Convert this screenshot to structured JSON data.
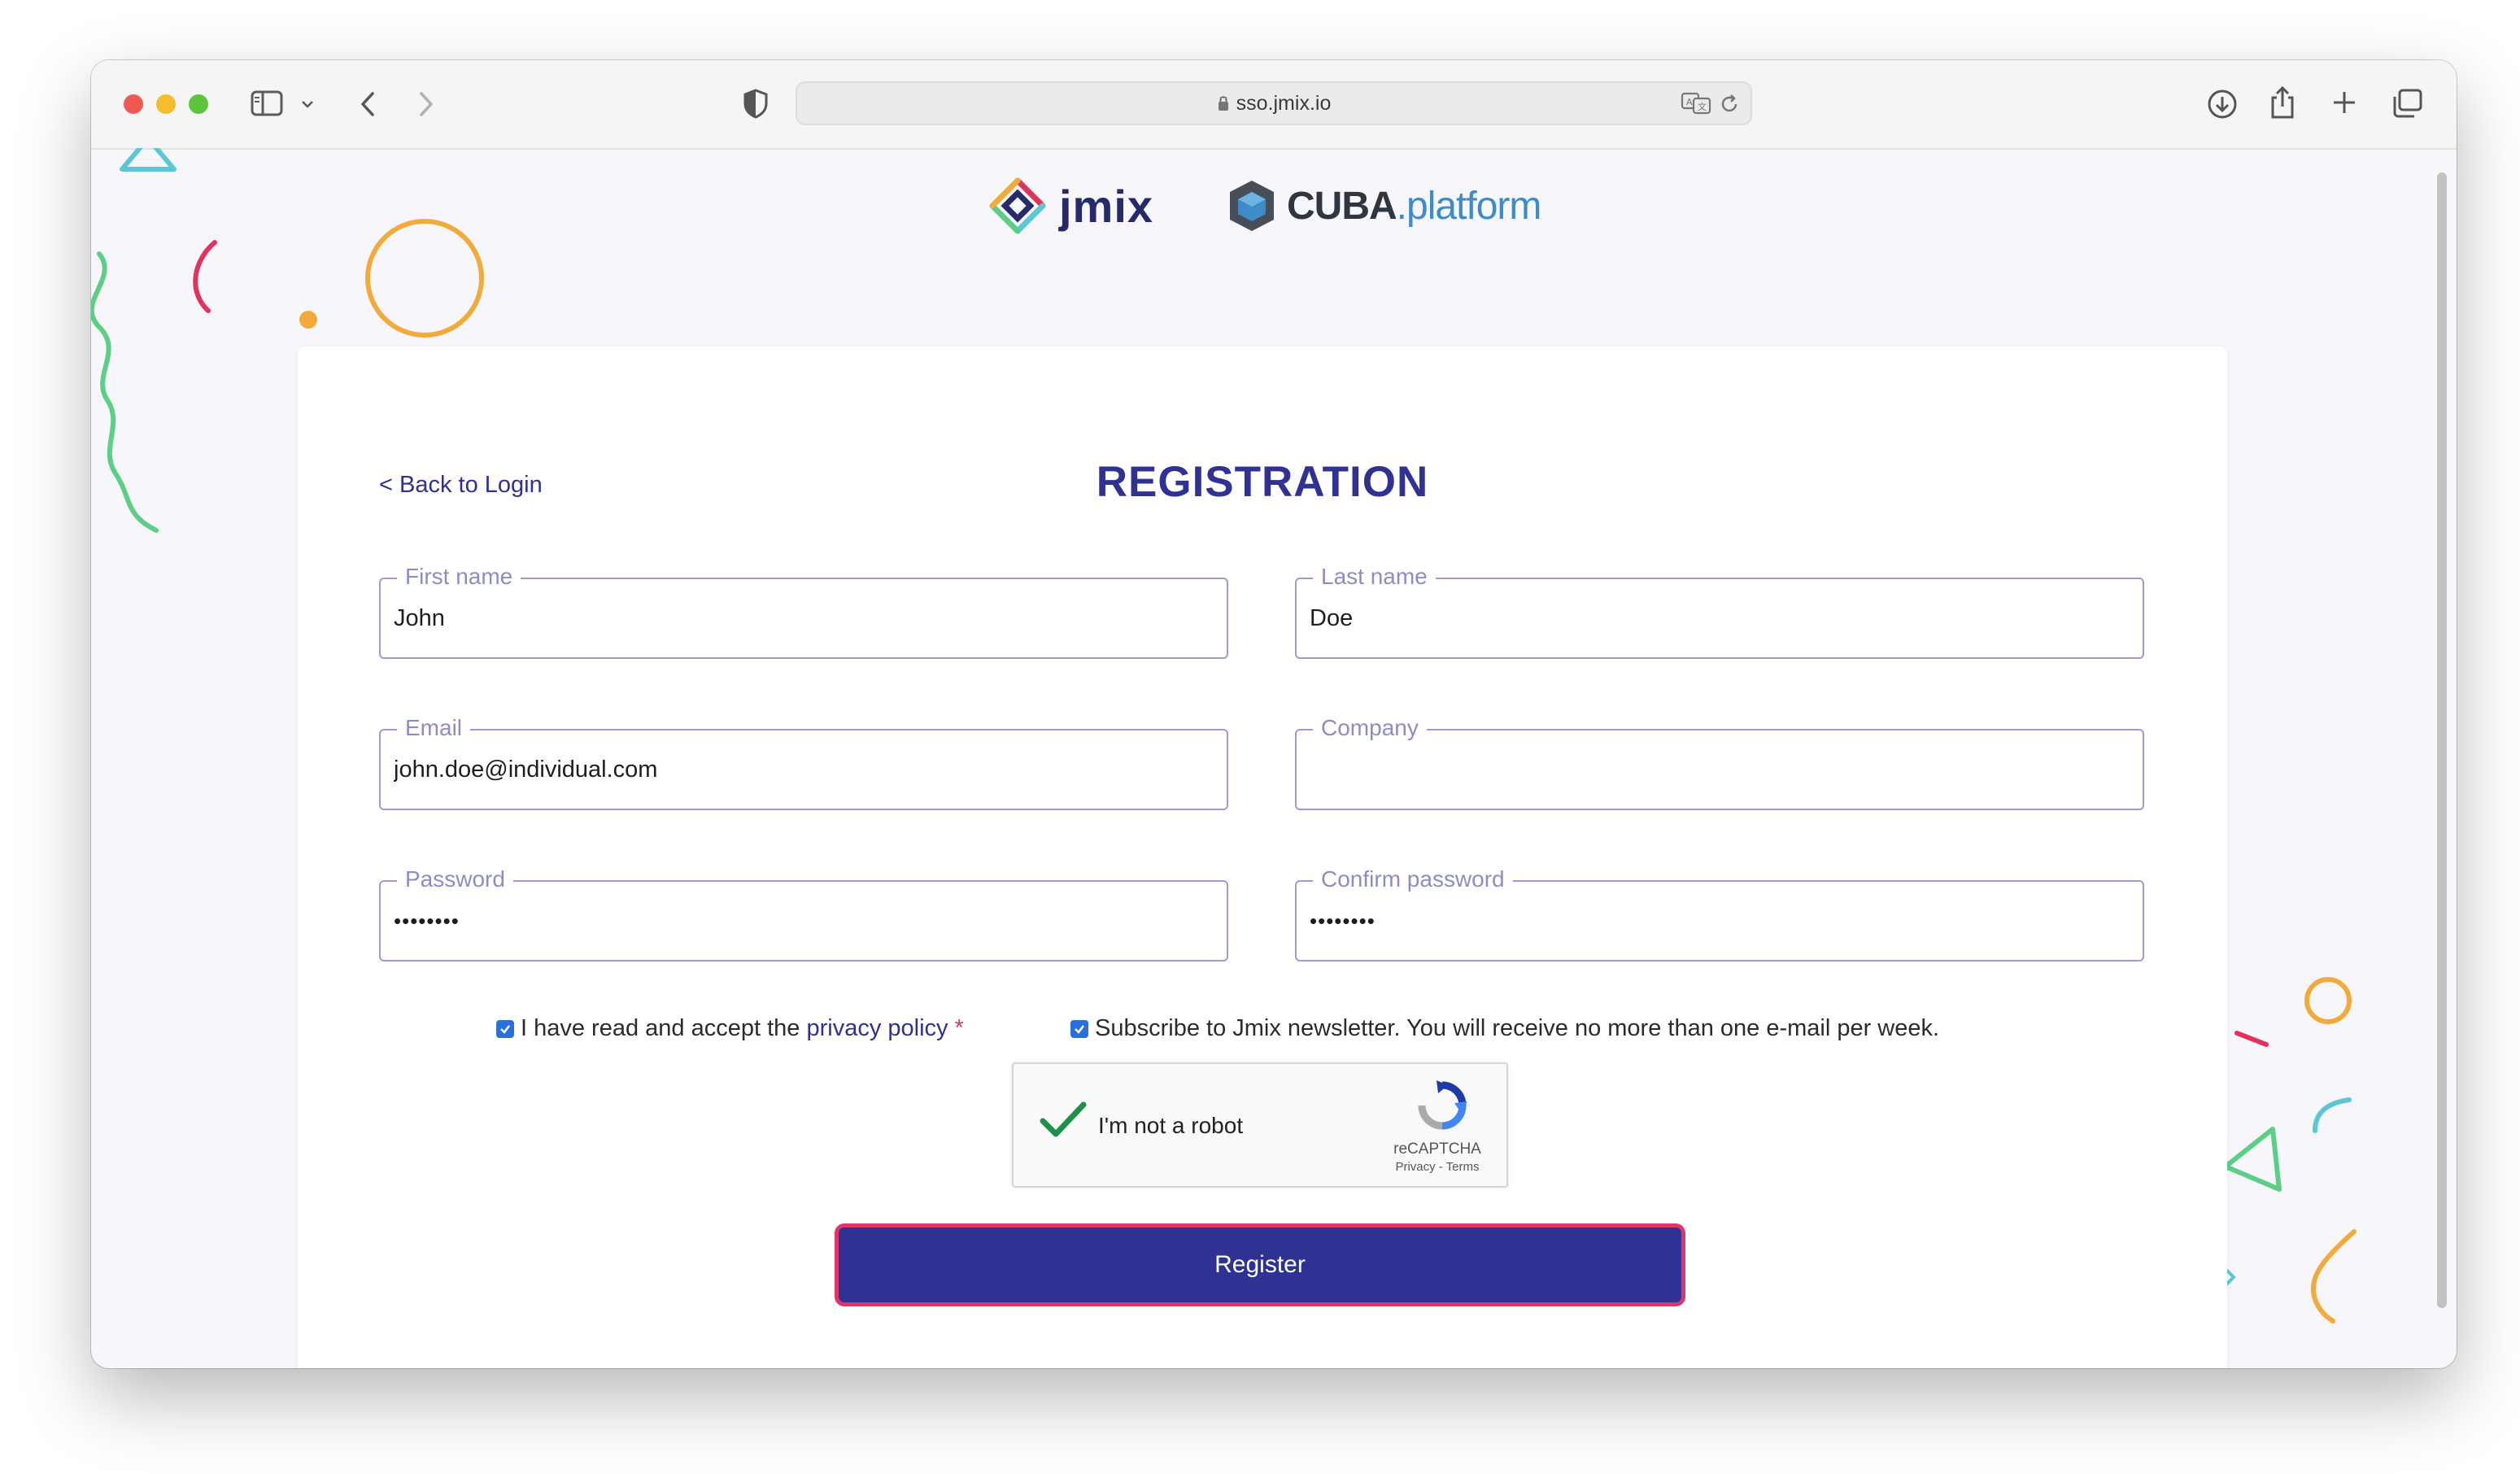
{
  "browser": {
    "url": "sso.jmix.io"
  },
  "logos": {
    "jmix": "jmix",
    "cuba_bold": "CUBA",
    "cuba_light": ".platform"
  },
  "form": {
    "back_link": "< Back to Login",
    "title": "REGISTRATION",
    "fields": {
      "first_name": {
        "label": "First name",
        "value": "John"
      },
      "last_name": {
        "label": "Last name",
        "value": "Doe"
      },
      "email": {
        "label": "Email",
        "value": "john.doe@individual.com"
      },
      "company": {
        "label": "Company",
        "value": ""
      },
      "password": {
        "label": "Password",
        "value": "••••••••"
      },
      "confirm_password": {
        "label": "Confirm password",
        "value": "••••••••"
      }
    },
    "privacy": {
      "checked": true,
      "text": "I have read and accept the",
      "link": "privacy policy",
      "required_mark": "*"
    },
    "newsletter": {
      "checked": true,
      "text": "Subscribe to Jmix newsletter. You will receive no more than one e-mail per week."
    },
    "captcha": {
      "checked": true,
      "label": "I'm not a robot",
      "brand": "reCAPTCHA",
      "terms": "Privacy - Terms"
    },
    "register_button": "Register"
  },
  "colors": {
    "primary": "#2f3193",
    "accent_border": "#e0346a",
    "field_border": "#9b9bce",
    "checkbox": "#2b6fd8"
  }
}
